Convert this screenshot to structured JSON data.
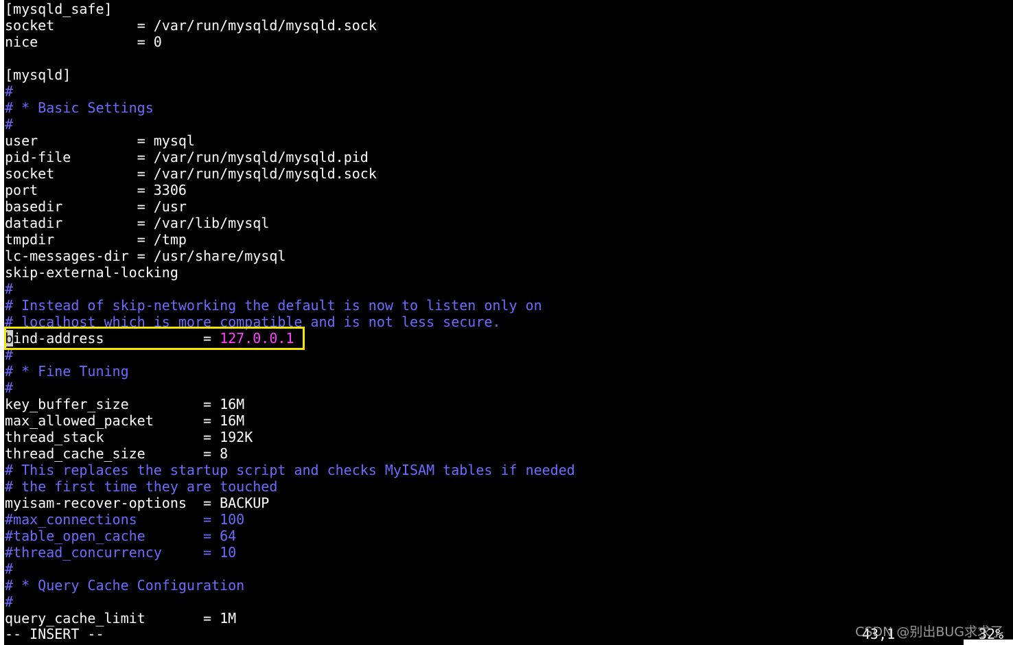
{
  "editor": {
    "lines": [
      {
        "type": "plain",
        "text": "[mysqld_safe]"
      },
      {
        "type": "kv",
        "key": "socket          ",
        "sep": "= ",
        "value": "/var/run/mysqld/mysqld.sock"
      },
      {
        "type": "kv",
        "key": "nice            ",
        "sep": "= ",
        "value": "0"
      },
      {
        "type": "plain",
        "text": ""
      },
      {
        "type": "plain",
        "text": "[mysqld]"
      },
      {
        "type": "comment",
        "text": "#"
      },
      {
        "type": "comment",
        "text": "# * Basic Settings"
      },
      {
        "type": "comment",
        "text": "#"
      },
      {
        "type": "kv",
        "key": "user            ",
        "sep": "= ",
        "value": "mysql"
      },
      {
        "type": "kv",
        "key": "pid-file        ",
        "sep": "= ",
        "value": "/var/run/mysqld/mysqld.pid"
      },
      {
        "type": "kv",
        "key": "socket          ",
        "sep": "= ",
        "value": "/var/run/mysqld/mysqld.sock"
      },
      {
        "type": "kv",
        "key": "port            ",
        "sep": "= ",
        "value": "3306"
      },
      {
        "type": "kv",
        "key": "basedir         ",
        "sep": "= ",
        "value": "/usr"
      },
      {
        "type": "kv",
        "key": "datadir         ",
        "sep": "= ",
        "value": "/var/lib/mysql"
      },
      {
        "type": "kv",
        "key": "tmpdir          ",
        "sep": "= ",
        "value": "/tmp"
      },
      {
        "type": "kv",
        "key": "lc-messages-dir ",
        "sep": "= ",
        "value": "/usr/share/mysql"
      },
      {
        "type": "plain",
        "text": "skip-external-locking"
      },
      {
        "type": "comment",
        "text": "#"
      },
      {
        "type": "comment",
        "text": "# Instead of skip-networking the default is now to listen only on"
      },
      {
        "type": "comment",
        "text": "# localhost which is more compatible and is not less secure."
      },
      {
        "type": "highlight",
        "cursor_char": "b",
        "key": "ind-address            ",
        "sep": "= ",
        "value": "127.0.0.1"
      },
      {
        "type": "comment",
        "text": "#"
      },
      {
        "type": "comment",
        "text": "# * Fine Tuning"
      },
      {
        "type": "comment",
        "text": "#"
      },
      {
        "type": "kv",
        "key": "key_buffer_size         ",
        "sep": "= ",
        "value": "16M"
      },
      {
        "type": "kv",
        "key": "max_allowed_packet      ",
        "sep": "= ",
        "value": "16M"
      },
      {
        "type": "kv",
        "key": "thread_stack            ",
        "sep": "= ",
        "value": "192K"
      },
      {
        "type": "kv",
        "key": "thread_cache_size       ",
        "sep": "= ",
        "value": "8"
      },
      {
        "type": "comment",
        "text": "# This replaces the startup script and checks MyISAM tables if needed"
      },
      {
        "type": "comment",
        "text": "# the first time they are touched"
      },
      {
        "type": "kv",
        "key": "myisam-recover-options  ",
        "sep": "= ",
        "value": "BACKUP"
      },
      {
        "type": "comment",
        "text": "#max_connections        = 100"
      },
      {
        "type": "comment",
        "text": "#table_open_cache       = 64"
      },
      {
        "type": "comment",
        "text": "#thread_concurrency     = 10"
      },
      {
        "type": "comment",
        "text": "#"
      },
      {
        "type": "comment",
        "text": "# * Query Cache Configuration"
      },
      {
        "type": "comment",
        "text": "#"
      },
      {
        "type": "kv",
        "key": "query_cache_limit       ",
        "sep": "= ",
        "value": "1M"
      }
    ]
  },
  "status_bar": {
    "mode": "-- INSERT --",
    "position": "43,1",
    "scroll": "32%"
  },
  "watermark": "CSDN @别出BUG求求了",
  "colors": {
    "background": "#000000",
    "text": "#ffffff",
    "comment": "#6b6bff",
    "highlight_value": "#ff40ff",
    "highlight_box": "#f5e600"
  }
}
